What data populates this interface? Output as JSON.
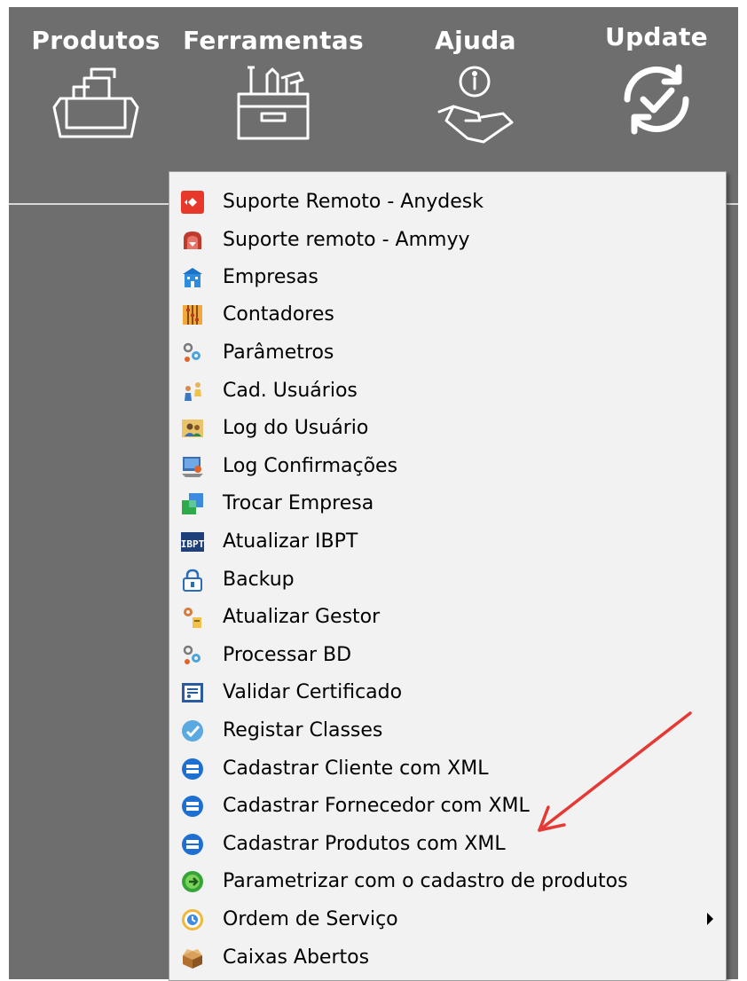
{
  "toolbar": {
    "items": [
      {
        "label": "Produtos",
        "icon": "box-icon"
      },
      {
        "label": "Ferramentas",
        "icon": "toolbox-icon"
      },
      {
        "label": "Ajuda",
        "icon": "help-hand-icon"
      },
      {
        "label": "Update",
        "icon": "update-icon"
      }
    ]
  },
  "menu": {
    "items": [
      {
        "label": "Suporte Remoto - Anydesk",
        "icon": "anydesk-icon"
      },
      {
        "label": "Suporte remoto - Ammyy",
        "icon": "ammyy-icon"
      },
      {
        "label": "Empresas",
        "icon": "building-icon"
      },
      {
        "label": "Contadores",
        "icon": "abacus-icon"
      },
      {
        "label": "Parâmetros",
        "icon": "gears-icon"
      },
      {
        "label": "Cad. Usuários",
        "icon": "users-icon"
      },
      {
        "label": "Log do Usuário",
        "icon": "user-log-icon"
      },
      {
        "label": "Log Confirmações",
        "icon": "confirm-log-icon"
      },
      {
        "label": "Trocar Empresa",
        "icon": "switch-company-icon"
      },
      {
        "label": "Atualizar IBPT",
        "icon": "ibpt-icon"
      },
      {
        "label": "Backup",
        "icon": "lock-icon"
      },
      {
        "label": "Atualizar Gestor",
        "icon": "update-manager-icon"
      },
      {
        "label": "Processar BD",
        "icon": "process-db-icon"
      },
      {
        "label": "Validar Certificado",
        "icon": "certificate-icon"
      },
      {
        "label": "Registar Classes",
        "icon": "register-check-icon"
      },
      {
        "label": "Cadastrar Cliente com XML",
        "icon": "xml-disk-icon"
      },
      {
        "label": "Cadastrar Fornecedor com XML",
        "icon": "xml-disk-icon"
      },
      {
        "label": "Cadastrar Produtos com XML",
        "icon": "xml-disk-icon"
      },
      {
        "label": "Parametrizar com o cadastro de produtos",
        "icon": "green-arrow-icon"
      },
      {
        "label": "Ordem de Serviço",
        "icon": "clock-icon",
        "has_submenu": true
      },
      {
        "label": "Caixas Abertos",
        "icon": "open-box-icon"
      }
    ]
  },
  "colors": {
    "toolbar_bg": "#6e6e6e",
    "menu_bg": "#f2f2f2",
    "annotation_arrow": "#e53935"
  }
}
